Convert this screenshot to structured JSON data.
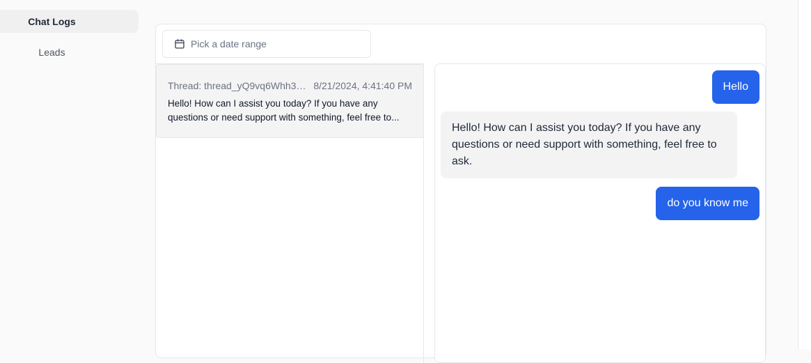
{
  "sidebar": {
    "items": [
      {
        "label": "Chat Logs",
        "active": true
      },
      {
        "label": "Leads",
        "active": false
      }
    ]
  },
  "filter": {
    "date_range_placeholder": "Pick a date range",
    "icon": "calendar-icon"
  },
  "threads": [
    {
      "id": "Thread: thread_yQ9vq6Whh39...",
      "timestamp": "8/21/2024, 4:41:40 PM",
      "preview": "Hello! How can I assist you today? If you have any questions or need support with something, feel free to..."
    }
  ],
  "messages": [
    {
      "role": "user",
      "text": "Hello"
    },
    {
      "role": "assistant",
      "text": "Hello! How can I assist you today? If you have any questions or need support with something, feel free to ask."
    },
    {
      "role": "user",
      "text": "do you know me"
    }
  ],
  "colors": {
    "accent": "#2563eb",
    "bubble_bot": "#f3f3f4"
  }
}
